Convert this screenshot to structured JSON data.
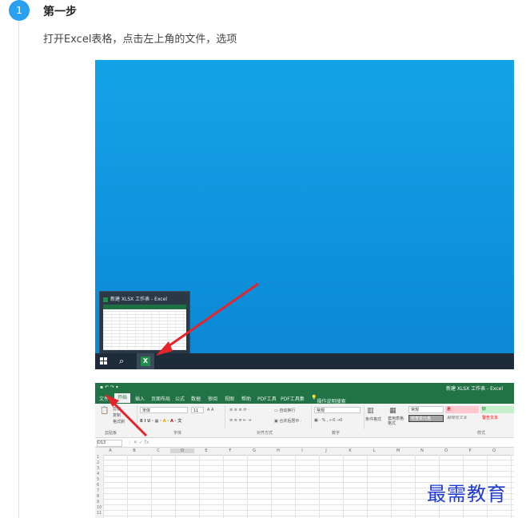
{
  "step": {
    "number": "1",
    "title": "第一步",
    "description": "打开Excel表格，点击左上角的文件，选项"
  },
  "desktop_screenshot": {
    "preview_title": "新建 XLSX 工作表 - Excel"
  },
  "excel_screenshot": {
    "window_title": "新建 XLSX 工作表 - Excel",
    "tabs": [
      "文件",
      "开始",
      "插入",
      "页面布局",
      "公式",
      "数据",
      "审阅",
      "视图",
      "帮助",
      "PDF工具",
      "PDF工具集",
      "操作说明搜索"
    ],
    "active_tab": "开始",
    "ribbon_groups": [
      "剪贴板",
      "字体",
      "对齐方式",
      "数字",
      "样式"
    ],
    "font_name": "宋体",
    "font_size": "11",
    "wrap_text": "自动换行",
    "merge_center": "合并后居中",
    "number_format": "常规",
    "cond_format": "条件格式",
    "table_format": "套用表格格式",
    "styles": {
      "normal": "常规",
      "bad": "差",
      "good": "好",
      "check_cell": "检查单元格",
      "explanatory": "解释性文本",
      "warning": "警告文本"
    },
    "paste_items": [
      "剪切",
      "复制",
      "格式刷"
    ],
    "name_box": "D13",
    "columns": [
      "A",
      "B",
      "C",
      "D",
      "E",
      "F",
      "G",
      "H",
      "I",
      "J",
      "K",
      "L",
      "M",
      "N",
      "O",
      "P",
      "Q"
    ],
    "rows": [
      "1",
      "2",
      "3",
      "4",
      "5",
      "6",
      "7",
      "8",
      "9",
      "10",
      "11"
    ]
  },
  "watermark": "最需教育",
  "colors": {
    "step_circle": "#2aa0f0",
    "desktop_bg": "#0f94dd",
    "excel_green": "#217346",
    "arrow_red": "#e5242b",
    "watermark": "#1f3bd3"
  }
}
